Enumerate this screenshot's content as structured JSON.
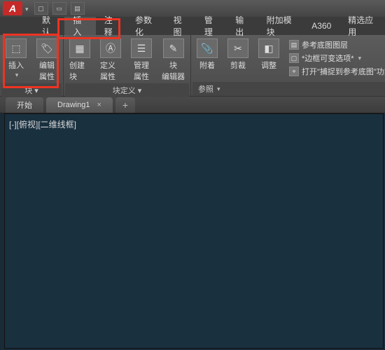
{
  "app": {
    "logo": "A"
  },
  "tabs": {
    "default": "默认",
    "insert": "插入",
    "annotate": "注释",
    "parametric": "参数化",
    "view": "视图",
    "manage": "管理",
    "output": "输出",
    "addons": "附加模块",
    "a360": "A360",
    "featured": "精选应用"
  },
  "panels": {
    "block": {
      "insert": "插入",
      "edit_attr": "编辑\n属性",
      "title": "块 ▾"
    },
    "blockdef": {
      "create": "创建块",
      "define_attr": "定义属性",
      "manage_attr": "管理\n属性",
      "block_editor": "块\n编辑器",
      "title": "块定义 ▾"
    },
    "ref": {
      "attach": "附着",
      "clip": "剪裁",
      "adjust": "调整",
      "underlay_layers": "参考底图图层",
      "frames_vary": "*边框可变选项*",
      "snap_underlay": "打开\"捕捉到参考底图\"功能",
      "title": "参照"
    }
  },
  "doc_tabs": {
    "start": "开始",
    "drawing1": "Drawing1",
    "close": "×",
    "plus": "+"
  },
  "viewport": {
    "label": "[-][俯视][二维线框]"
  }
}
